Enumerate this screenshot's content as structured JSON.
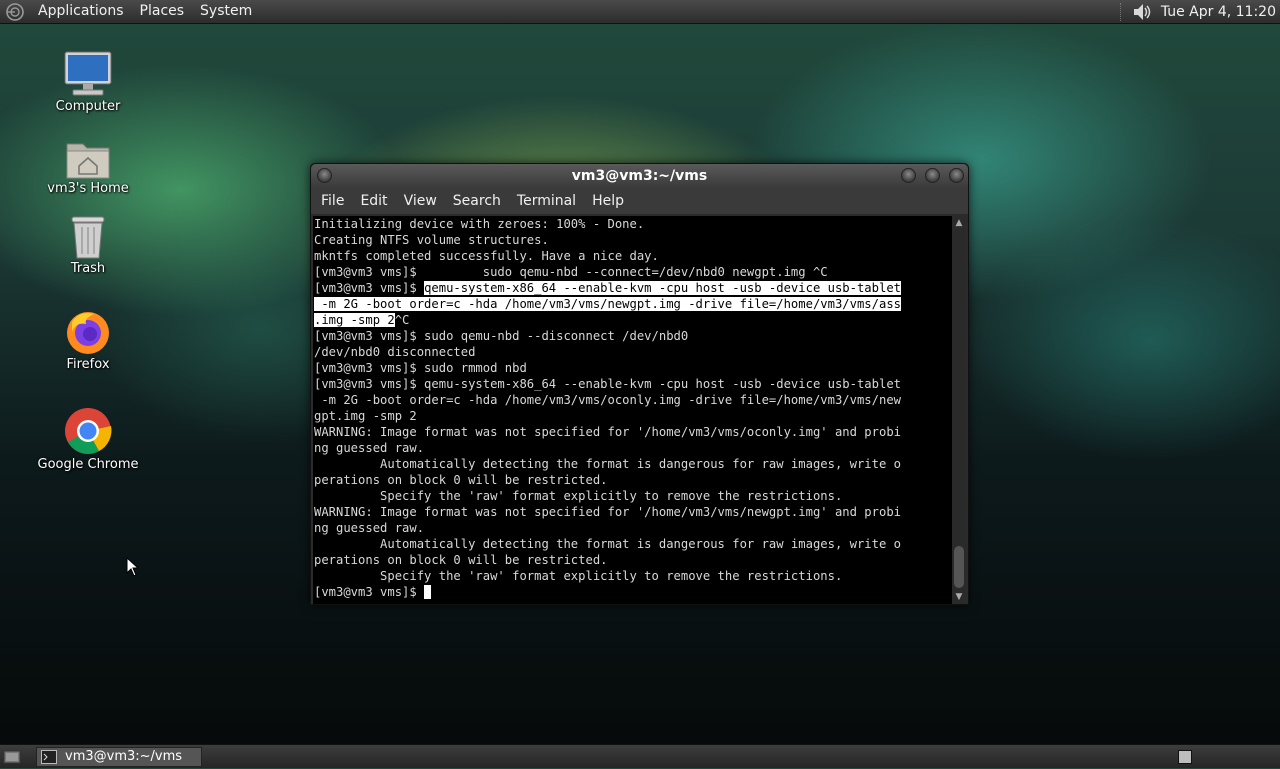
{
  "top_panel": {
    "menus": [
      "Applications",
      "Places",
      "System"
    ],
    "clock": "Tue Apr  4, 11:20",
    "icons": [
      "distro-icon",
      "volume-icon"
    ]
  },
  "desktop": {
    "icons": [
      {
        "label": "Computer",
        "icon": "computer-icon"
      },
      {
        "label": "vm3's Home",
        "icon": "home-folder-icon"
      },
      {
        "label": "Trash",
        "icon": "trash-icon"
      },
      {
        "label": "Firefox",
        "icon": "firefox-icon"
      },
      {
        "label": "Google Chrome",
        "icon": "chrome-icon"
      }
    ]
  },
  "terminal": {
    "title": "vm3@vm3:~/vms",
    "menus": [
      "File",
      "Edit",
      "View",
      "Search",
      "Terminal",
      "Help"
    ],
    "lines": [
      "Initializing device with zeroes: 100% - Done.",
      "Creating NTFS volume structures.",
      "mkntfs completed successfully. Have a nice day.",
      "[vm3@vm3 vms]$         sudo qemu-nbd --connect=/dev/nbd0 newgpt.img ^C",
      "[vm3@vm3 vms]$ ",
      "qemu-system-x86_64 --enable-kvm -cpu host -usb -device usb-tablet",
      " -m 2G -boot order=c -hda /home/vm3/vms/newgpt.img -drive file=/home/vm3/vms/ass",
      ".img -smp 2",
      "^C",
      "[vm3@vm3 vms]$ sudo qemu-nbd --disconnect /dev/nbd0",
      "/dev/nbd0 disconnected",
      "[vm3@vm3 vms]$ sudo rmmod nbd",
      "[vm3@vm3 vms]$ qemu-system-x86_64 --enable-kvm -cpu host -usb -device usb-tablet",
      " -m 2G -boot order=c -hda /home/vm3/vms/oconly.img -drive file=/home/vm3/vms/new",
      "gpt.img -smp 2",
      "WARNING: Image format was not specified for '/home/vm3/vms/oconly.img' and probi",
      "ng guessed raw.",
      "         Automatically detecting the format is dangerous for raw images, write o",
      "perations on block 0 will be restricted.",
      "         Specify the 'raw' format explicitly to remove the restrictions.",
      "WARNING: Image format was not specified for '/home/vm3/vms/newgpt.img' and probi",
      "ng guessed raw.",
      "         Automatically detecting the format is dangerous for raw images, write o",
      "perations on block 0 will be restricted.",
      "         Specify the 'raw' format explicitly to remove the restrictions.",
      "[vm3@vm3 vms]$ "
    ]
  },
  "bottom_panel": {
    "task_label": "vm3@vm3:~/vms"
  }
}
